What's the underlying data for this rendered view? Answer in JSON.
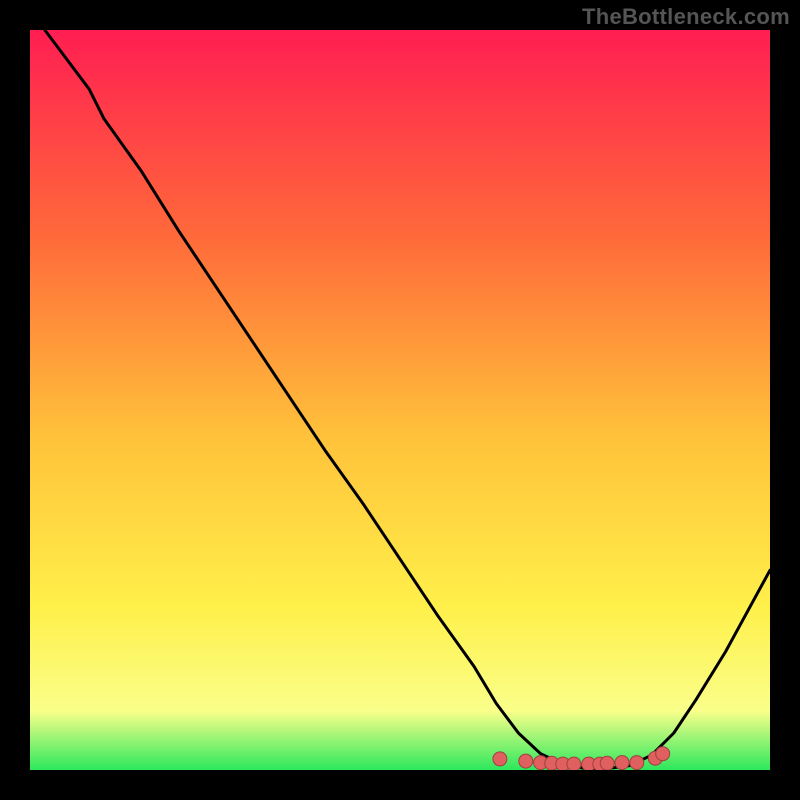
{
  "watermark": "TheBottleneck.com",
  "colors": {
    "page_bg": "#000000",
    "watermark_text": "#555555",
    "gradient_top": "#FF1E52",
    "gradient_mid1": "#FF6A3A",
    "gradient_mid2": "#FFC23A",
    "gradient_mid3": "#FFF04A",
    "gradient_mid4": "#FAFF8A",
    "gradient_bottom": "#2CE85D",
    "curve_stroke": "#000000",
    "dot_fill": "#E06060",
    "dot_stroke": "#A04040"
  },
  "chart_data": {
    "type": "line",
    "title": "",
    "xlabel": "",
    "ylabel": "",
    "xlim": [
      0,
      100
    ],
    "ylim": [
      0,
      100
    ],
    "series": [
      {
        "name": "bottleneck-curve",
        "x": [
          2,
          8,
          10,
          15,
          20,
          25,
          30,
          35,
          40,
          45,
          50,
          55,
          60,
          63,
          66,
          69,
          72,
          75,
          78,
          81,
          84,
          87,
          90,
          94,
          100
        ],
        "y": [
          100,
          92,
          88,
          81,
          73,
          65.5,
          58,
          50.5,
          43,
          36,
          28.5,
          21,
          14,
          9,
          5,
          2.2,
          0.8,
          0.2,
          0.2,
          0.6,
          2,
          5,
          9.5,
          16,
          27
        ]
      }
    ],
    "highlight_points": {
      "name": "optimal-range-dots",
      "x": [
        63.5,
        67,
        69,
        70.5,
        72,
        73.5,
        75.5,
        77,
        78,
        80,
        82,
        84.5,
        85.5
      ],
      "y": [
        1.5,
        1.2,
        1.0,
        0.9,
        0.8,
        0.8,
        0.8,
        0.8,
        0.9,
        1.0,
        1.0,
        1.6,
        2.2
      ]
    },
    "notes": "No axis tick labels or legend are visible in the image. The plot background is a vertical red→orange→yellow→green gradient. A black V-shaped curve descends from top-left to a minimum near x≈76 and rises again. Salmon dots lie along the trough."
  }
}
